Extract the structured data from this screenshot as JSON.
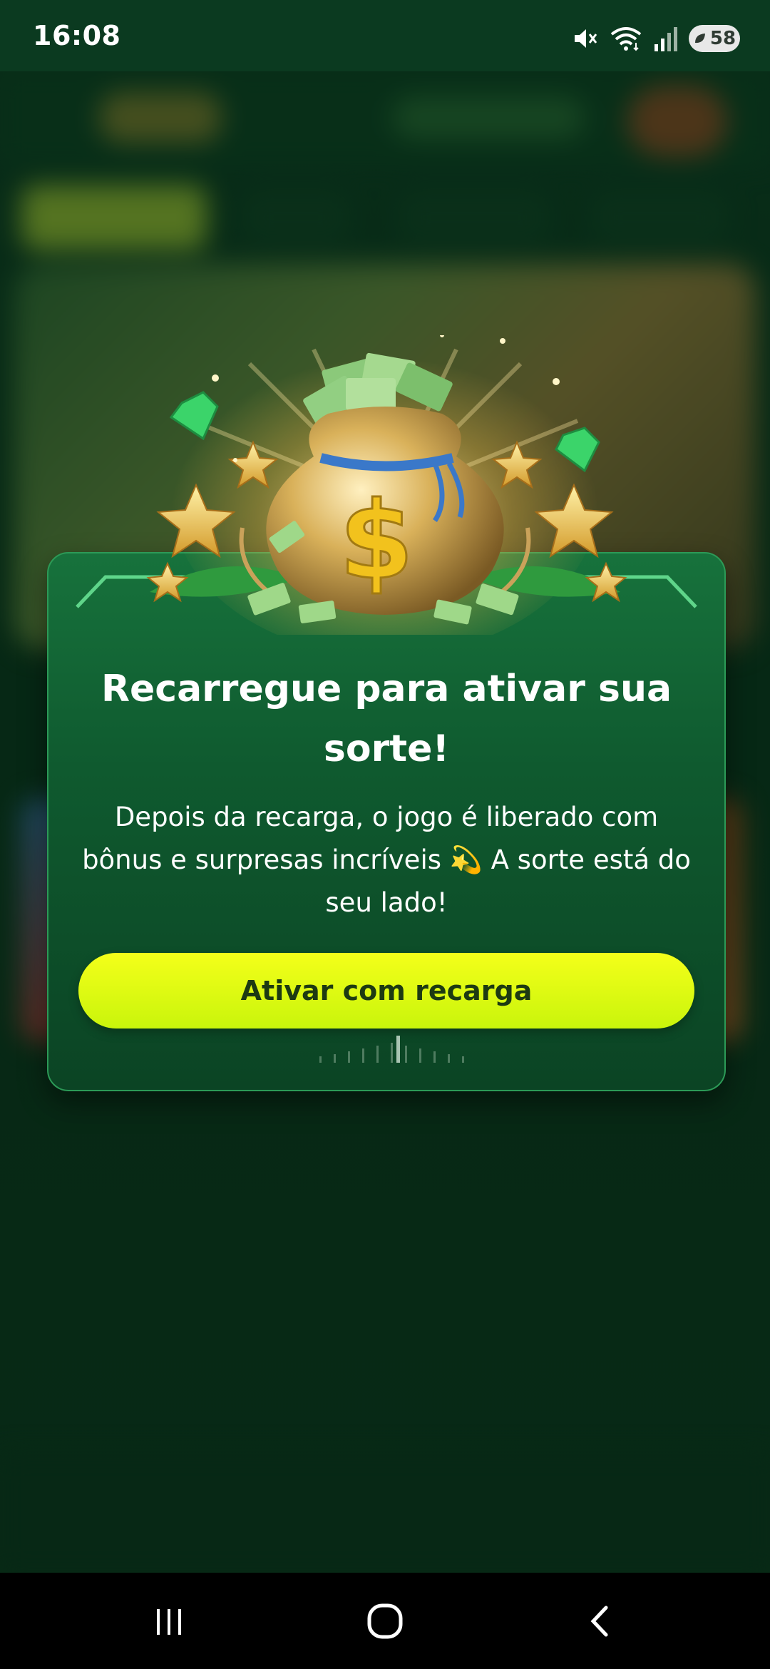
{
  "status_bar": {
    "time": "16:08",
    "battery_level": "58",
    "icons": [
      "mute-icon",
      "wifi-icon",
      "signal-icon",
      "battery-saver-icon"
    ]
  },
  "modal": {
    "title": "Recarregue para ativar sua sorte!",
    "body": "Depois da recarga, o jogo é liberado com bônus e surpresas incríveis 💫 A sorte está do seu lado!",
    "cta_label": "Ativar com recarga",
    "illustration": "money-bag-with-stars-and-gems",
    "colors": {
      "modal_green": "#17723c",
      "cta_yellow": "#f4ff1a",
      "cta_text": "#1d3a12"
    }
  },
  "system_nav": {
    "buttons": [
      "recent-apps-icon",
      "home-icon",
      "back-icon"
    ]
  }
}
